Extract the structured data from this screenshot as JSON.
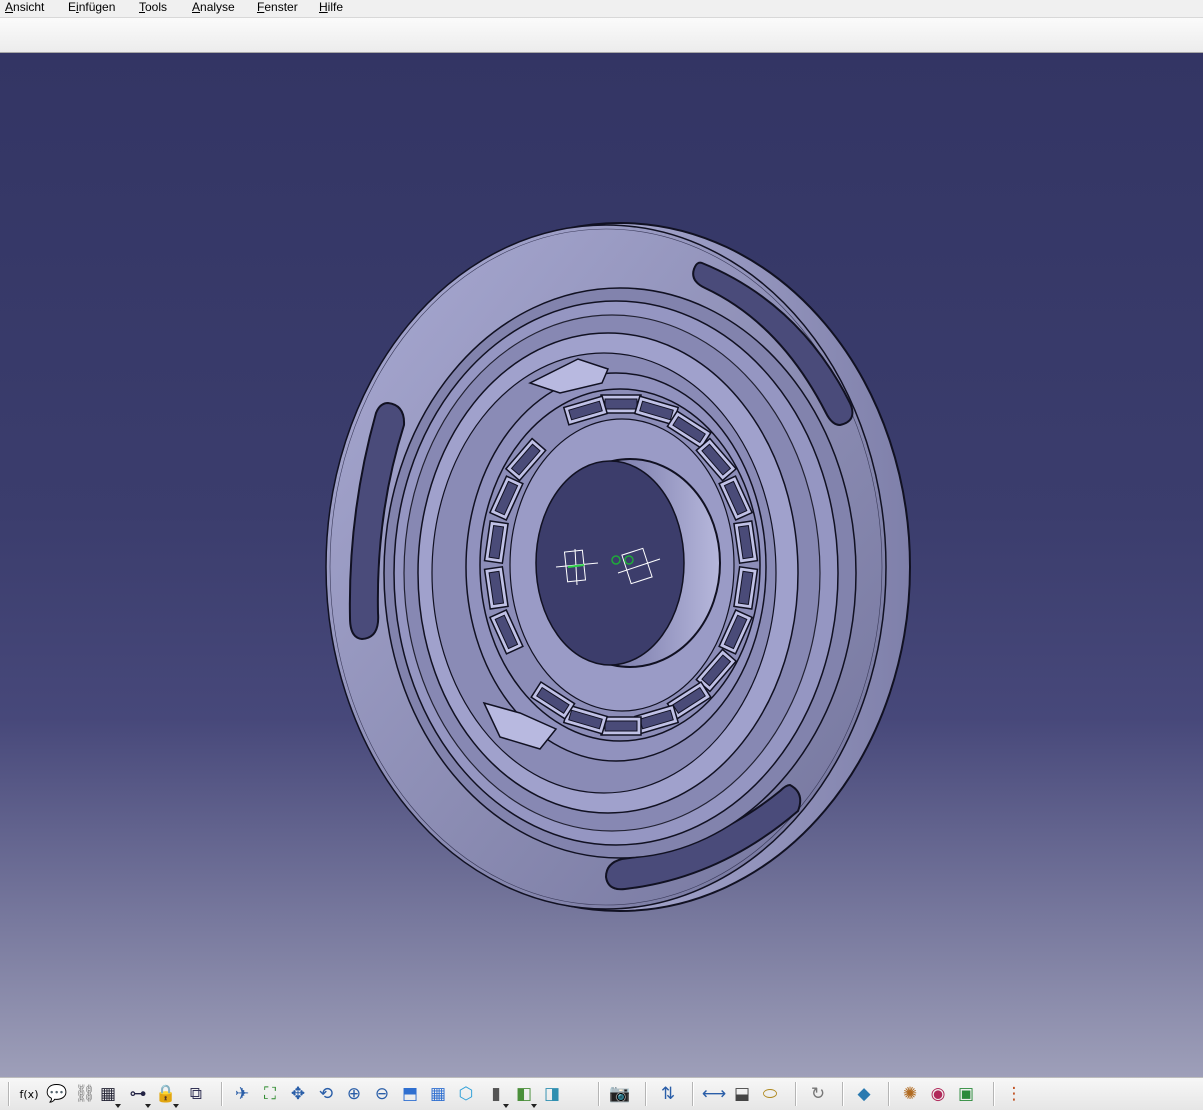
{
  "menu": {
    "items": [
      {
        "label": "Ansicht",
        "underline_index": 0
      },
      {
        "label": "Einfügen",
        "underline_index": 1
      },
      {
        "label": "Tools",
        "underline_index": 0
      },
      {
        "label": "Analyse",
        "underline_index": 0
      },
      {
        "label": "Fenster",
        "underline_index": 0
      },
      {
        "label": "Hilfe",
        "underline_index": 0
      }
    ]
  },
  "viewport": {
    "background_top": "#333564",
    "background_bottom": "#9e9fb9",
    "part_color": "#8c8db4",
    "part_light": "#b9bade",
    "part_dark": "#5d5e8a",
    "edge_color": "#111122"
  },
  "bottom_toolbar": {
    "buttons": [
      {
        "name": "formula-icon",
        "glyph": "f(x)"
      },
      {
        "name": "comment-icon",
        "glyph": "💬"
      },
      {
        "name": "chain-icon",
        "glyph": "⛓"
      },
      {
        "name": "table-icon",
        "glyph": "▦"
      },
      {
        "name": "tree-structure-icon",
        "glyph": "⊶"
      },
      {
        "name": "lock-knowledge-icon",
        "glyph": "🔒"
      },
      {
        "name": "rule-icon",
        "glyph": "⧉"
      },
      {
        "name": "fly-mode-icon",
        "glyph": "✈"
      },
      {
        "name": "fit-all-icon",
        "glyph": "⛶"
      },
      {
        "name": "pan-icon",
        "glyph": "✥"
      },
      {
        "name": "rotate-icon",
        "glyph": "⟲"
      },
      {
        "name": "zoom-in-icon",
        "glyph": "⊕"
      },
      {
        "name": "zoom-out-icon",
        "glyph": "⊖"
      },
      {
        "name": "normal-view-icon",
        "glyph": "⬒"
      },
      {
        "name": "grid-view-icon",
        "glyph": "▦"
      },
      {
        "name": "iso-view-icon",
        "glyph": "⬡"
      },
      {
        "name": "shading-icon",
        "glyph": "▮"
      },
      {
        "name": "hide-show-icon",
        "glyph": "◧"
      },
      {
        "name": "swap-space-icon",
        "glyph": "◨"
      },
      {
        "name": "camera-icon",
        "glyph": "📷"
      },
      {
        "name": "update-icon",
        "glyph": "⇅"
      },
      {
        "name": "measure-between-icon",
        "glyph": "⟷"
      },
      {
        "name": "measure-item-icon",
        "glyph": "⬓"
      },
      {
        "name": "measure-inertia-icon",
        "glyph": "⬭"
      },
      {
        "name": "refresh-icon",
        "glyph": "↻"
      },
      {
        "name": "apply-material-icon",
        "glyph": "◆"
      },
      {
        "name": "render-icon",
        "glyph": "✺"
      },
      {
        "name": "scene-icon",
        "glyph": "◉"
      },
      {
        "name": "environment-icon",
        "glyph": "▣"
      },
      {
        "name": "snap-grid-icon",
        "glyph": "⋮"
      }
    ]
  }
}
